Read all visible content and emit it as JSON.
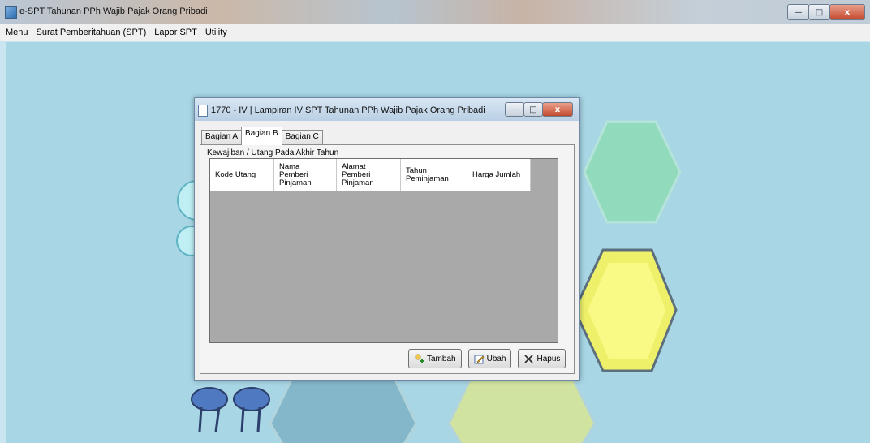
{
  "app": {
    "title": "e-SPT Tahunan PPh Wajib Pajak Orang Pribadi"
  },
  "menu": [
    "Menu",
    "Surat Pemberitahuan (SPT)",
    "Lapor SPT",
    "Utility"
  ],
  "window_controls": {
    "minimize": "—",
    "maximize": "□",
    "close": "x"
  },
  "dialog": {
    "title": "1770 - IV | Lampiran IV SPT Tahunan PPh Wajib Pajak Orang Pribadi",
    "tabs": [
      "Bagian A",
      "Bagian B",
      "Bagian C"
    ],
    "active_tab": "Bagian B",
    "section_label": "Kewajiban / Utang Pada Akhir Tahun",
    "table": {
      "columns": [
        "Kode Utang",
        "Nama\nPemberi\nPinjaman",
        "Alamat\nPemberi\nPinjaman",
        "Tahun\nPeminjaman",
        "Harga Jumlah"
      ],
      "rows": []
    },
    "buttons": {
      "tambah": {
        "label": "Tambah",
        "icon": "add-user-icon"
      },
      "ubah": {
        "label": "Ubah",
        "icon": "edit-icon"
      },
      "hapus": {
        "label": "Hapus",
        "icon": "delete-x-icon"
      }
    }
  },
  "colors": {
    "desktop_bg": "#a8d6e5",
    "grid_bg": "#a9a9a9",
    "hex_green": "#7ed9a8",
    "hex_yellow": "#f2f25a"
  }
}
